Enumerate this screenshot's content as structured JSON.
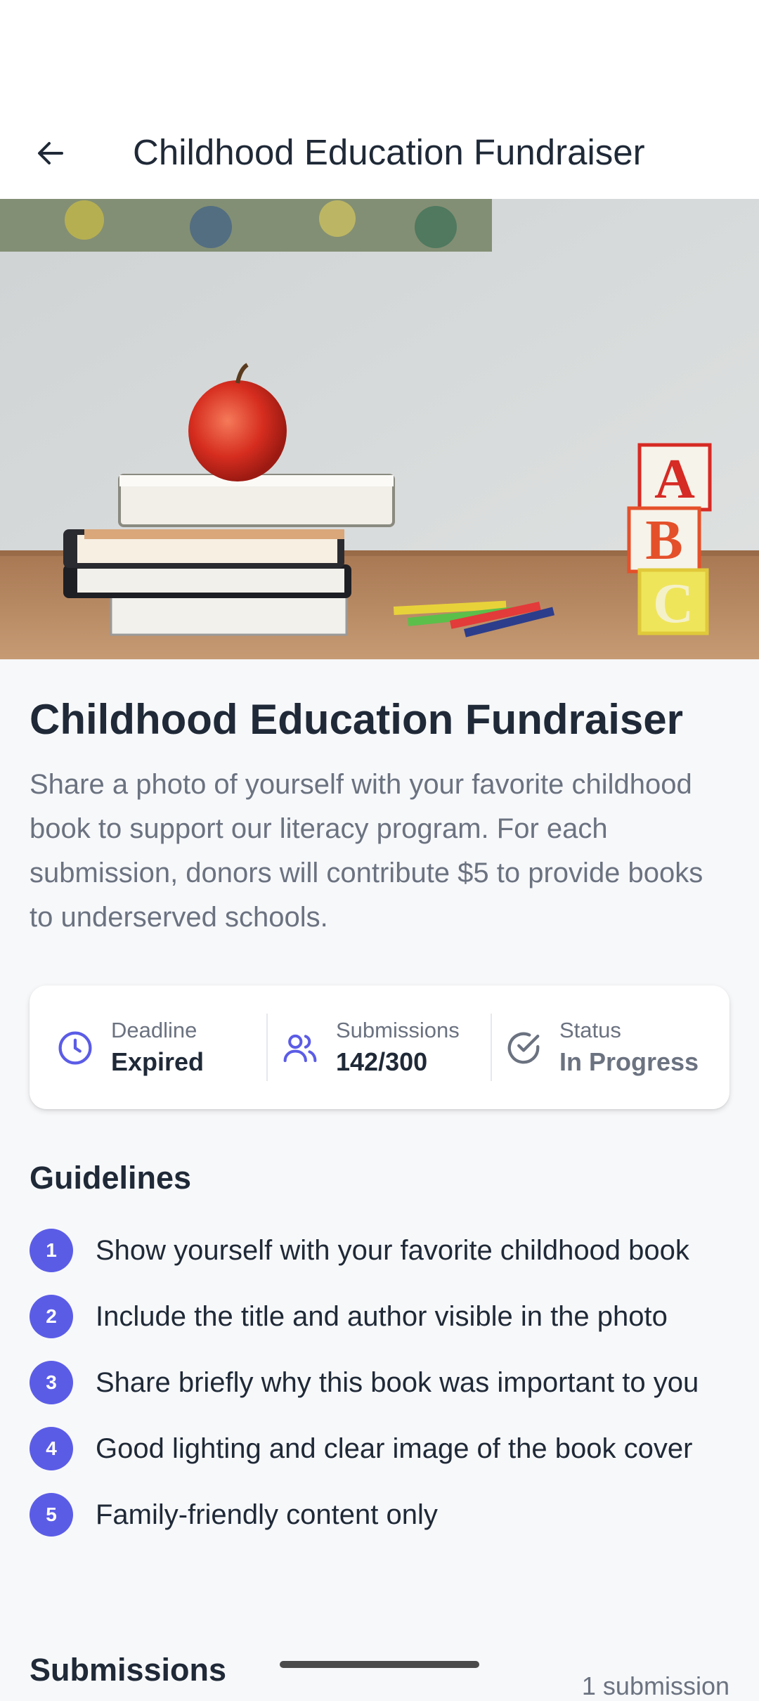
{
  "app_bar": {
    "title": "Childhood Education Fundraiser",
    "back_icon": "arrow-left-icon"
  },
  "hero": {
    "icon": "hero-photo"
  },
  "campaign": {
    "title": "Childhood Education Fundraiser",
    "description": "Share a photo of yourself with your favorite childhood book to support our literacy program. For each submission, donors will contribute $5 to provide books to underserved schools."
  },
  "stats": {
    "deadline": {
      "label": "Deadline",
      "value": "Expired",
      "icon": "clock-icon"
    },
    "submissions": {
      "label": "Submissions",
      "value": "142/300",
      "icon": "users-icon"
    },
    "status": {
      "label": "Status",
      "value": "In Progress",
      "icon": "check-circle-icon"
    }
  },
  "guidelines": {
    "heading": "Guidelines",
    "items": [
      {
        "number": "1",
        "text": "Show yourself with your favorite childhood book"
      },
      {
        "number": "2",
        "text": "Include the title and author visible in the photo"
      },
      {
        "number": "3",
        "text": "Share briefly why this book was important to you"
      },
      {
        "number": "4",
        "text": "Good lighting and clear image of the book cover"
      },
      {
        "number": "5",
        "text": "Family-friendly content only"
      }
    ]
  },
  "submissions_section": {
    "heading": "Submissions",
    "count": "1 submission"
  },
  "colors": {
    "accent": "#5b5ce6",
    "text_primary": "#1f2937",
    "text_secondary": "#6b7280",
    "background": "#f7f8fa"
  }
}
